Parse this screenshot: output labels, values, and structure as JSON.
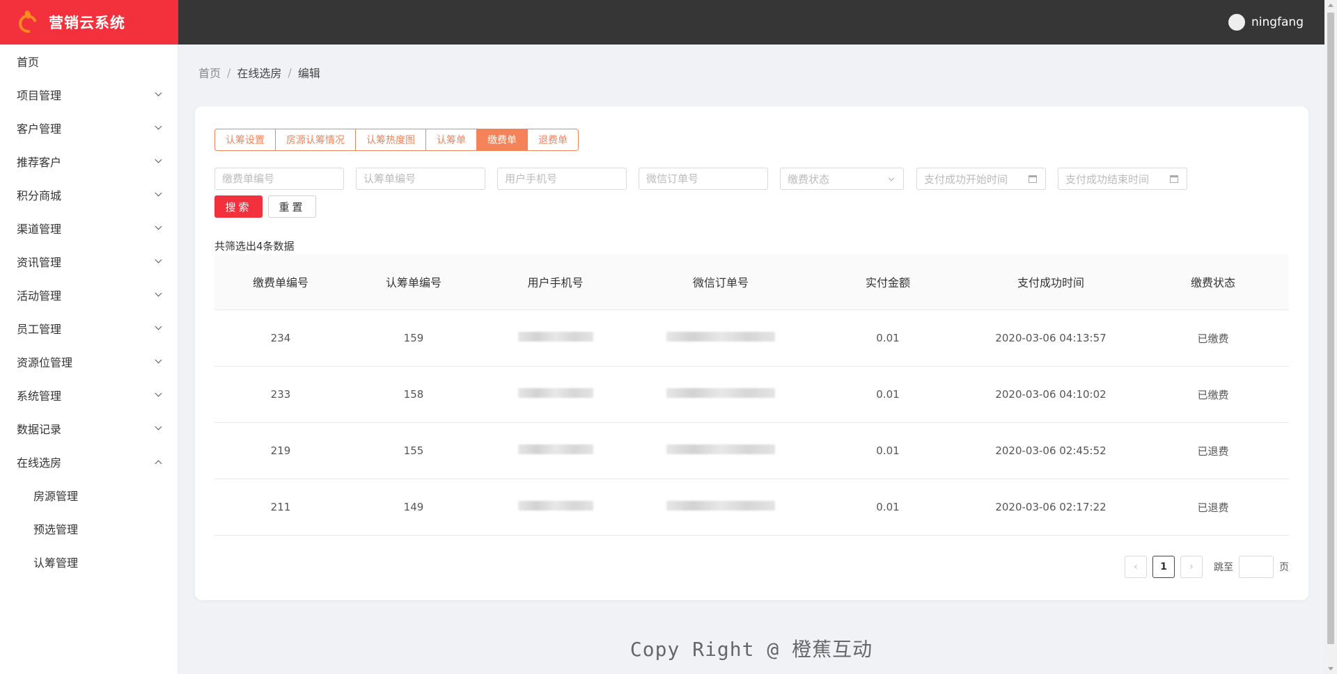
{
  "app": {
    "title": "营销云系统"
  },
  "user": {
    "name": "ningfang"
  },
  "sidebar": {
    "items": [
      {
        "label": "首页",
        "expandable": false
      },
      {
        "label": "项目管理",
        "expandable": true
      },
      {
        "label": "客户管理",
        "expandable": true
      },
      {
        "label": "推荐客户",
        "expandable": true
      },
      {
        "label": "积分商城",
        "expandable": true
      },
      {
        "label": "渠道管理",
        "expandable": true
      },
      {
        "label": "资讯管理",
        "expandable": true
      },
      {
        "label": "活动管理",
        "expandable": true
      },
      {
        "label": "员工管理",
        "expandable": true
      },
      {
        "label": "资源位管理",
        "expandable": true
      },
      {
        "label": "系统管理",
        "expandable": true
      },
      {
        "label": "数据记录",
        "expandable": true
      },
      {
        "label": "在线选房",
        "expandable": true,
        "expanded": true
      }
    ],
    "subitems": [
      "房源管理",
      "预选管理",
      "认筹管理"
    ]
  },
  "breadcrumb": [
    "首页",
    "在线选房",
    "编辑"
  ],
  "tabs": [
    {
      "label": "认筹设置",
      "active": false
    },
    {
      "label": "房源认筹情况",
      "active": false
    },
    {
      "label": "认筹热度图",
      "active": false
    },
    {
      "label": "认筹单",
      "active": false
    },
    {
      "label": "缴费单",
      "active": true
    },
    {
      "label": "退费单",
      "active": false
    }
  ],
  "filters": {
    "payment_no": "缴费单编号",
    "subscription_no": "认筹单编号",
    "phone": "用户手机号",
    "wechat_order": "微信订单号",
    "status": "缴费状态",
    "start_time": "支付成功开始时间",
    "end_time": "支付成功结束时间"
  },
  "buttons": {
    "search": "搜索",
    "reset": "重置"
  },
  "result_count": "共筛选出4条数据",
  "table": {
    "headers": [
      "缴费单编号",
      "认筹单编号",
      "用户手机号",
      "微信订单号",
      "实付金额",
      "支付成功时间",
      "缴费状态"
    ],
    "rows": [
      {
        "payment_no": "234",
        "subscription_no": "159",
        "amount": "0.01",
        "time": "2020-03-06 04:13:57",
        "status": "已缴费"
      },
      {
        "payment_no": "233",
        "subscription_no": "158",
        "amount": "0.01",
        "time": "2020-03-06 04:10:02",
        "status": "已缴费"
      },
      {
        "payment_no": "219",
        "subscription_no": "155",
        "amount": "0.01",
        "time": "2020-03-06 02:45:52",
        "status": "已退费"
      },
      {
        "payment_no": "211",
        "subscription_no": "149",
        "amount": "0.01",
        "time": "2020-03-06 02:17:22",
        "status": "已退费"
      }
    ]
  },
  "pagination": {
    "current_page": "1",
    "jump_label": "跳至",
    "page_suffix": "页"
  },
  "footer": "Copy Right @ 橙蕉互动",
  "colors": {
    "brand_red": "#f2313c",
    "accent_orange": "#f4835a",
    "header_dark": "#363636"
  }
}
